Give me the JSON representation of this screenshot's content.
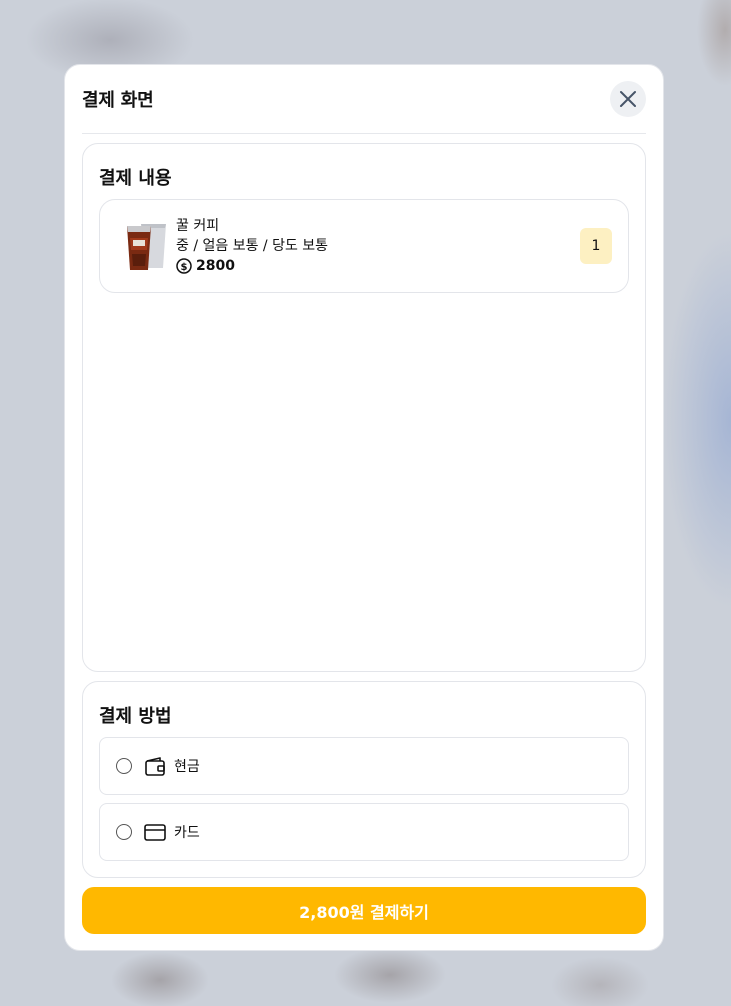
{
  "modal": {
    "title": "결제 화면",
    "close_icon": "close-icon"
  },
  "order": {
    "title": "결제 내용",
    "items": [
      {
        "name": "꿀 커피",
        "options": "중 / 얼음 보통 / 당도 보통",
        "price": "2800",
        "price_icon": "dollar-circle-icon",
        "quantity": "1",
        "thumbnail": "iced-coffee-cup-image"
      }
    ]
  },
  "payment": {
    "title": "결제 방법",
    "methods": [
      {
        "label": "현금",
        "icon": "wallet-icon",
        "selected": false
      },
      {
        "label": "카드",
        "icon": "credit-card-icon",
        "selected": false
      }
    ]
  },
  "pay_button": {
    "label": "2,800원 결제하기"
  },
  "colors": {
    "accent": "#ffb800",
    "quantity_badge": "#fdf0c2"
  }
}
